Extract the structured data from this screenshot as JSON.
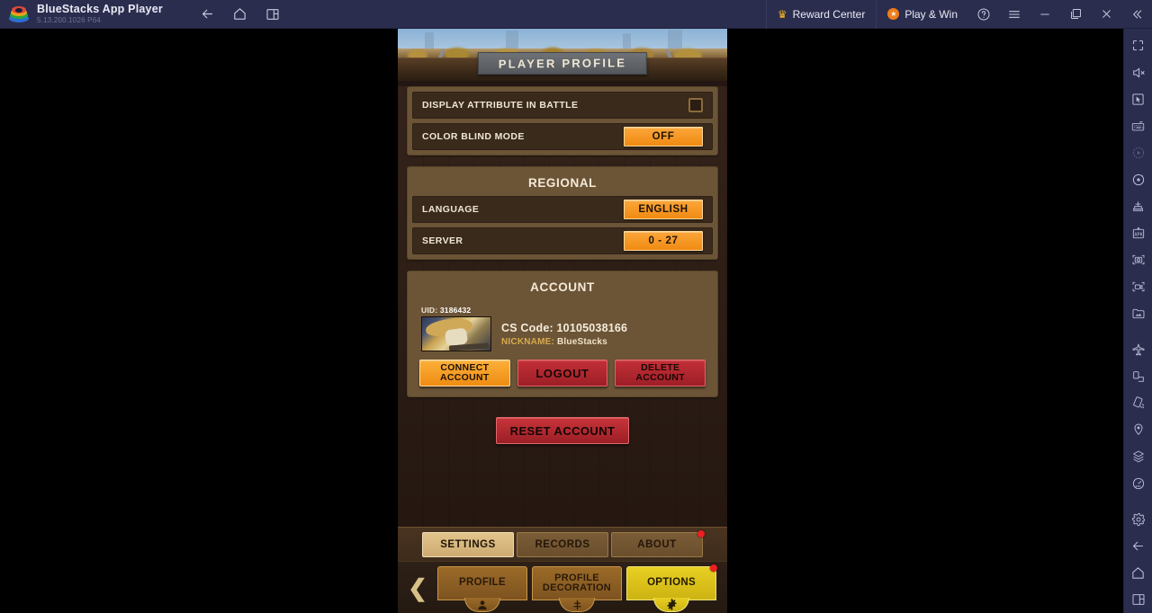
{
  "titlebar": {
    "app_name": "BlueStacks App Player",
    "version": "5.13.200.1026 P64",
    "logo_icon": "bluestacks-logo",
    "nav": [
      {
        "name": "back-icon",
        "label": "Back"
      },
      {
        "name": "home-icon",
        "label": "Home"
      },
      {
        "name": "multi-instance-icon",
        "label": "Multi Instance"
      }
    ],
    "reward_center": "Reward Center",
    "reward_icon": "crown-icon",
    "play_and_win": "Play & Win",
    "play_icon": "star-badge-icon",
    "help_icon": "help-circle-icon",
    "menu_icon": "hamburger-menu-icon",
    "minimize_icon": "minimize-icon",
    "maximize_icon": "maximize-restore-icon",
    "close_icon": "close-icon",
    "collapse_icon": "double-chevron-left-icon"
  },
  "sidebar": {
    "items": [
      {
        "name": "fullscreen-icon",
        "label": "Fullscreen"
      },
      {
        "name": "mute-icon",
        "label": "Mute"
      },
      {
        "name": "cursor-control-icon",
        "label": "Game Controls"
      },
      {
        "name": "keyboard-icon",
        "label": "Keymapping"
      },
      {
        "name": "macro-play-icon",
        "label": "Macro Play",
        "dim": true
      },
      {
        "name": "macro-record-icon",
        "label": "Macro Recorder"
      },
      {
        "name": "eco-mode-icon",
        "label": "Eco Mode"
      },
      {
        "name": "install-apk-icon",
        "label": "Install APK"
      },
      {
        "name": "screenshot-icon",
        "label": "Screenshot"
      },
      {
        "name": "screen-record-icon",
        "label": "Screen Record"
      },
      {
        "name": "media-manager-icon",
        "label": "Media Manager"
      },
      {
        "name": "airplane-mode-icon",
        "label": "Airplane Mode"
      },
      {
        "name": "rotate-screen-icon",
        "label": "Rotate"
      },
      {
        "name": "shake-icon",
        "label": "Shake"
      },
      {
        "name": "location-icon",
        "label": "Location"
      },
      {
        "name": "multi-layer-icon",
        "label": "Layers"
      },
      {
        "name": "performance-icon",
        "label": "Performance"
      },
      {
        "name": "settings-gear-icon",
        "label": "Settings"
      },
      {
        "name": "back-icon",
        "label": "Back"
      },
      {
        "name": "home-icon",
        "label": "Home"
      },
      {
        "name": "recent-apps-icon",
        "label": "Recent Apps"
      }
    ]
  },
  "game": {
    "header_title": "PLAYER PROFILE",
    "display_panel": {
      "rows": [
        {
          "label": "DISPLAY ATTRIBUTE IN BATTLE",
          "control": "checkbox",
          "checked": false
        },
        {
          "label": "COLOR BLIND MODE",
          "control": "button",
          "value": "OFF"
        }
      ]
    },
    "regional_panel": {
      "title": "REGIONAL",
      "rows": [
        {
          "label": "LANGUAGE",
          "value": "ENGLISH"
        },
        {
          "label": "SERVER",
          "value": "0 - 27"
        }
      ]
    },
    "account_panel": {
      "title": "ACCOUNT",
      "uid_label": "UID:",
      "uid_value": "3186432",
      "avatar_icon": "player-avatar",
      "cs_code": "CS Code: 10105038166",
      "nickname_label": "NICKNAME:",
      "nickname_value": "BlueStacks",
      "buttons": [
        {
          "label_line1": "CONNECT",
          "label_line2": "ACCOUNT",
          "style": "orange"
        },
        {
          "label_line1": "LOGOUT",
          "label_line2": "",
          "style": "red"
        },
        {
          "label_line1": "DELETE",
          "label_line2": "ACCOUNT",
          "style": "red"
        }
      ]
    },
    "reset_button": "RESET ACCOUNT",
    "sub_tabs": [
      {
        "label": "SETTINGS",
        "active": true,
        "badge": false
      },
      {
        "label": "RECORDS",
        "active": false,
        "badge": false
      },
      {
        "label": "ABOUT",
        "active": false,
        "badge": true
      }
    ],
    "back_arrow_icon": "chevron-left-icon",
    "bottom_tabs": [
      {
        "line1": "PROFILE",
        "line2": "",
        "icon": "person-icon",
        "active": false,
        "badge": false
      },
      {
        "line1": "PROFILE",
        "line2": "DECORATION",
        "icon": "decoration-icon",
        "active": false,
        "badge": false
      },
      {
        "line1": "OPTIONS",
        "line2": "",
        "icon": "gear-icon",
        "active": true,
        "badge": true
      }
    ]
  },
  "colors": {
    "titlebar_bg": "#2b2d4e",
    "panel_bg": "#6c5437",
    "row_bg": "#3a2a1c",
    "accent_orange": "#f08a12",
    "accent_red": "#c32f36",
    "accent_yellow": "#e8cf22",
    "badge_red": "#ee1f22"
  }
}
